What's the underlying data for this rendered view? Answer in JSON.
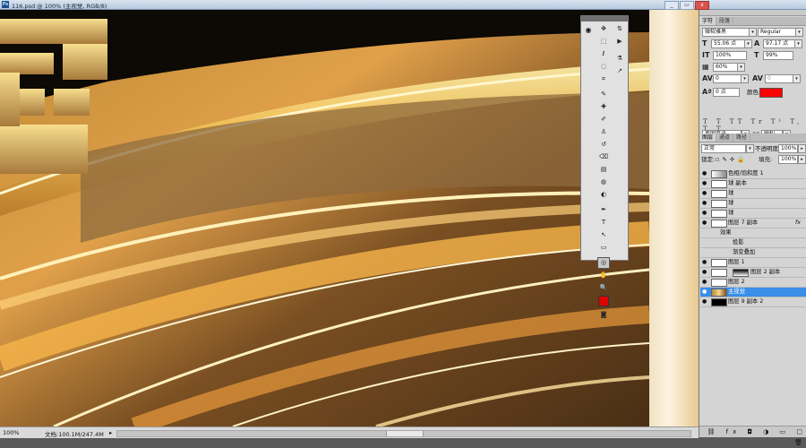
{
  "window": {
    "title": "116.psd @ 100% (主视觉, RGB/8)",
    "app_icon": "Ps",
    "buttons": {
      "minimize": "_",
      "restore": "▭",
      "close": "x"
    }
  },
  "statusbar": {
    "zoom": "100%",
    "doc_info": "文档:100.1M/247.4M",
    "arrow": "▸"
  },
  "toolbox": {
    "tools": [
      "move-icon",
      "marquee-icon",
      "lasso-icon",
      "quick-select-icon",
      "crop-icon",
      "eyedropper-icon",
      "healing-brush-icon",
      "brush-icon",
      "clone-stamp-icon",
      "history-brush-icon",
      "eraser-icon",
      "gradient-icon",
      "blur-icon",
      "dodge-icon",
      "pen-icon",
      "type-icon",
      "path-select-icon",
      "shape-icon",
      "3d-rotate-icon",
      "hand-icon",
      "zoom-icon"
    ],
    "tool_glyphs": [
      "✥",
      "⬚",
      "ℓ",
      "◌",
      "⌗",
      "✎",
      "✚",
      "✐",
      "♙",
      "↺",
      "⌫",
      "▤",
      "◍",
      "◐",
      "✒",
      "T",
      "↖",
      "▭",
      "◎",
      "✋",
      "🔍"
    ],
    "foreground_color": "#e00000",
    "side_glyphs": [
      "⇅",
      "▶",
      "⚗",
      "↗"
    ]
  },
  "character_panel": {
    "tabs": [
      "字符",
      "段落"
    ],
    "font_family": "微软雅黑",
    "font_style": "Regular",
    "font_size": "55.06 点",
    "leading": "97.17 点",
    "vertical_scale": "100%",
    "horizontal_scale": "99%",
    "tracking_percent": "60%",
    "kerning": "0",
    "tracking": "0",
    "baseline_shift": "0 点",
    "color_label": "颜色:",
    "text_color": "#ff0000",
    "type_styles": "T T TT Tr T¹ T, T T",
    "language": "美国英语",
    "antialias_icon": "aa",
    "antialias": "锐利"
  },
  "layers_panel": {
    "tabs": [
      "图层",
      "通道",
      "路径"
    ],
    "blend_mode": "正常",
    "opacity_label": "不透明度:",
    "opacity": "100%",
    "lock_label": "锁定:",
    "fill_label": "填充:",
    "fill": "100%",
    "layers": [
      {
        "name": "色相/饱和度 1",
        "type": "adjustment",
        "selected": false,
        "fx": ""
      },
      {
        "name": "球 副本",
        "type": "normal",
        "selected": false,
        "fx": ""
      },
      {
        "name": "球",
        "type": "normal",
        "selected": false,
        "fx": ""
      },
      {
        "name": "球",
        "type": "normal",
        "selected": false,
        "fx": ""
      },
      {
        "name": "球",
        "type": "normal",
        "selected": false,
        "fx": ""
      },
      {
        "name": "图层 7 副本",
        "type": "normal",
        "selected": false,
        "fx": "fx"
      },
      {
        "name": "效果",
        "type": "effect-group",
        "selected": false,
        "fx": ""
      },
      {
        "name": "投影",
        "type": "effect",
        "selected": false,
        "fx": ""
      },
      {
        "name": "渐变叠加",
        "type": "effect",
        "selected": false,
        "fx": ""
      },
      {
        "name": "图层 1",
        "type": "normal",
        "selected": false,
        "fx": ""
      },
      {
        "name": "图层 2 副本",
        "type": "masked",
        "selected": false,
        "fx": ""
      },
      {
        "name": "图层 2",
        "type": "normal",
        "selected": false,
        "fx": ""
      },
      {
        "name": "主视觉",
        "type": "image",
        "selected": true,
        "fx": ""
      },
      {
        "name": "图层 9 副本 2",
        "type": "black",
        "selected": false,
        "fx": ""
      }
    ],
    "bottom_icons": [
      "link-icon",
      "fx-icon",
      "mask-icon",
      "adjustment-icon",
      "group-icon",
      "new-layer-icon",
      "trash-icon"
    ],
    "bottom_glyphs": "⛓ fx ◘ ◑ ▭ ▢ 🗑"
  },
  "canvas": {
    "partial_character": "囧"
  }
}
